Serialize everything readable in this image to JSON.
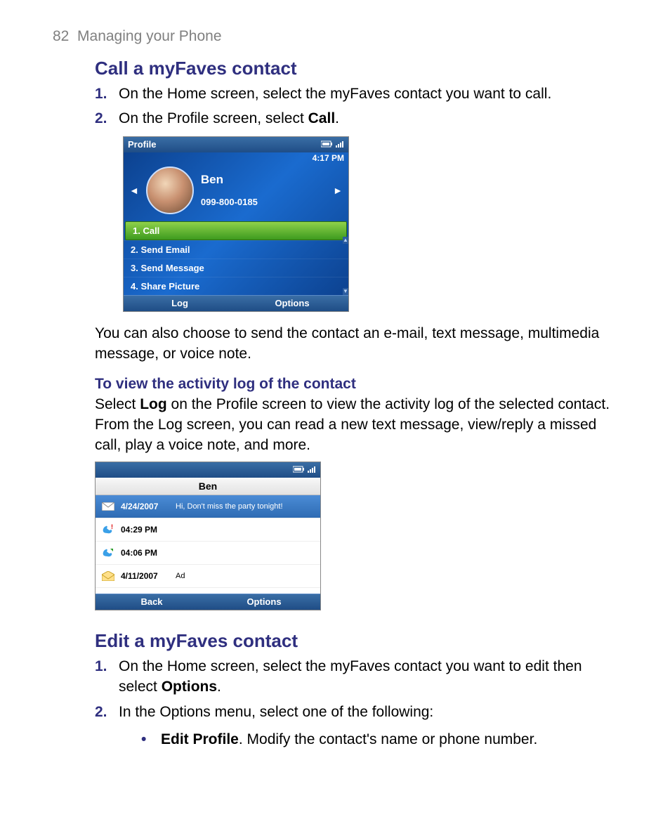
{
  "header": {
    "page_number": "82",
    "chapter": "Managing your Phone"
  },
  "section1": {
    "title": "Call a myFaves contact",
    "steps": [
      {
        "num": "1.",
        "text": "On the Home screen, select the myFaves contact you want to call."
      },
      {
        "num": "2.",
        "prefix": "On the Profile screen, select ",
        "bold": "Call",
        "suffix": "."
      }
    ],
    "after_para": "You can also choose to send the contact an e-mail, text message, multimedia message, or voice note.",
    "subheading": "To view the activity log of the contact",
    "sub_para_prefix": "Select ",
    "sub_para_bold": "Log",
    "sub_para_suffix": " on the Profile screen to view the activity log of the selected contact. From the Log screen, you can read a new text message, view/reply a missed call, play a voice note, and more."
  },
  "phone1": {
    "title": "Profile",
    "time": "4:17 PM",
    "contact_name": "Ben",
    "contact_phone": "099-800-0185",
    "menu": [
      {
        "label": "1. Call",
        "selected": true
      },
      {
        "label": "2. Send Email",
        "selected": false
      },
      {
        "label": "3. Send Message",
        "selected": false
      },
      {
        "label": "4. Share Picture",
        "selected": false
      }
    ],
    "softkey_left": "Log",
    "softkey_right": "Options"
  },
  "phone2": {
    "header_name": "Ben",
    "rows": [
      {
        "icon": "mail",
        "date": "4/24/2007",
        "text": "Hi, Don't miss the party tonight!",
        "selected": true
      },
      {
        "icon": "missed-call",
        "date": "04:29 PM",
        "text": "",
        "selected": false
      },
      {
        "icon": "out-call",
        "date": "04:06 PM",
        "text": "",
        "selected": false
      },
      {
        "icon": "mail-open",
        "date": "4/11/2007",
        "text": "Ad",
        "selected": false
      }
    ],
    "softkey_left": "Back",
    "softkey_right": "Options"
  },
  "section2": {
    "title": "Edit a myFaves contact",
    "steps": [
      {
        "num": "1.",
        "prefix": "On the Home screen, select the myFaves contact you want to edit then select ",
        "bold": "Options",
        "suffix": "."
      },
      {
        "num": "2.",
        "text": "In the Options menu, select one of the following:"
      }
    ],
    "bullets": [
      {
        "bold": "Edit Profile",
        "suffix": ". Modify the contact's name or phone number."
      }
    ]
  }
}
